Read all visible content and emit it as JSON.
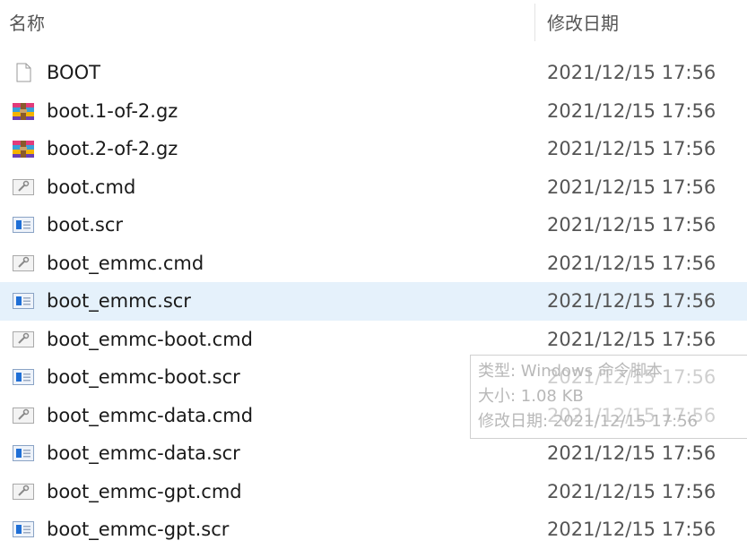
{
  "header": {
    "name_label": "名称",
    "date_label": "修改日期"
  },
  "files": [
    {
      "name": "BOOT",
      "date": "2021/12/15 17:56",
      "icon": "blank-file-icon"
    },
    {
      "name": "boot.1-of-2.gz",
      "date": "2021/12/15 17:56",
      "icon": "archive-icon"
    },
    {
      "name": "boot.2-of-2.gz",
      "date": "2021/12/15 17:56",
      "icon": "archive-icon"
    },
    {
      "name": "boot.cmd",
      "date": "2021/12/15 17:56",
      "icon": "cmd-file-icon"
    },
    {
      "name": "boot.scr",
      "date": "2021/12/15 17:56",
      "icon": "script-file-icon"
    },
    {
      "name": "boot_emmc.cmd",
      "date": "2021/12/15 17:56",
      "icon": "cmd-file-icon"
    },
    {
      "name": "boot_emmc.scr",
      "date": "2021/12/15 17:56",
      "icon": "script-file-icon",
      "selected": true
    },
    {
      "name": "boot_emmc-boot.cmd",
      "date": "2021/12/15 17:56",
      "icon": "cmd-file-icon"
    },
    {
      "name": "boot_emmc-boot.scr",
      "date": "2021/12/15 17:56",
      "icon": "script-file-icon"
    },
    {
      "name": "boot_emmc-data.cmd",
      "date": "2021/12/15 17:56",
      "icon": "cmd-file-icon"
    },
    {
      "name": "boot_emmc-data.scr",
      "date": "2021/12/15 17:56",
      "icon": "script-file-icon"
    },
    {
      "name": "boot_emmc-gpt.cmd",
      "date": "2021/12/15 17:56",
      "icon": "cmd-file-icon"
    },
    {
      "name": "boot_emmc-gpt.scr",
      "date": "2021/12/15 17:56",
      "icon": "script-file-icon"
    }
  ],
  "tooltip": {
    "type_line": "类型: Windows 命令脚本",
    "size_line": "大小: 1.08 KB",
    "date_line": "修改日期: 2021/12/15 17:56"
  },
  "colors": {
    "selected_row": "#e5f1fb",
    "script_icon_blue": "#1f6fd6",
    "archive_icon_colors": [
      "#e23b7a",
      "#3aa0d8",
      "#f4b400",
      "#6a3fb5"
    ]
  }
}
